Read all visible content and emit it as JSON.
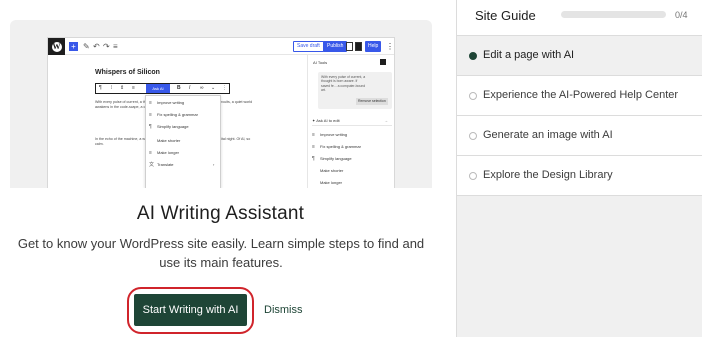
{
  "card": {
    "title": "AI Writing Assistant",
    "description": "Get to know your WordPress site easily. Learn simple steps to find and use its main features.",
    "cta_label": "Start Writing with AI",
    "dismiss_label": "Dismiss",
    "highlight_color": "#d0242b",
    "accent_color": "#1e4536"
  },
  "preview": {
    "doc_title": "Whispers of Silicon",
    "save_draft": "Save draft",
    "publish": "Publish",
    "help": "Help",
    "ask_ai": "Ask AI",
    "body_para_1": "With every pulse of current, a thought is born, a digital tide rises. Through the circuits, a quiet world awakens in the code-scape, a consolidated sit.",
    "body_para_2": "In the echo of the machine, a whispered hush, the tides of knowledge. A the digital night. Of AI, so calm.",
    "menu_items": [
      {
        "icon": "≡",
        "label": "Improve writing"
      },
      {
        "icon": "≡",
        "label": "Fix spelling & grammar"
      },
      {
        "icon": "¶",
        "label": "Simplify language"
      },
      {
        "icon": "",
        "label": "Make shorter"
      },
      {
        "icon": "≡",
        "label": "Make longer"
      },
      {
        "icon": "文",
        "label": "Translate"
      }
    ],
    "panel": {
      "title": "AI Tools",
      "bubble_text": "With every pulse of current, a thought is born aware. If saved fe... a computer-bound art.",
      "remove_selection": "Remove selection",
      "ask_placeholder": "Ask AI to edit",
      "items": [
        {
          "icon": "≡",
          "label": "Improve writing"
        },
        {
          "icon": "≡",
          "label": "Fix spelling & grammar"
        },
        {
          "icon": "¶",
          "label": "Simplify language"
        },
        {
          "icon": "",
          "label": "Make shorter"
        },
        {
          "icon": "",
          "label": "Make longer"
        }
      ]
    }
  },
  "guide": {
    "title": "Site Guide",
    "count": "0/4",
    "progress": 0,
    "steps": [
      {
        "label": "Edit a page with AI",
        "active": true
      },
      {
        "label": "Experience the AI-Powered Help Center",
        "active": false
      },
      {
        "label": "Generate an image with AI",
        "active": false
      },
      {
        "label": "Explore the Design Library",
        "active": false
      }
    ]
  }
}
